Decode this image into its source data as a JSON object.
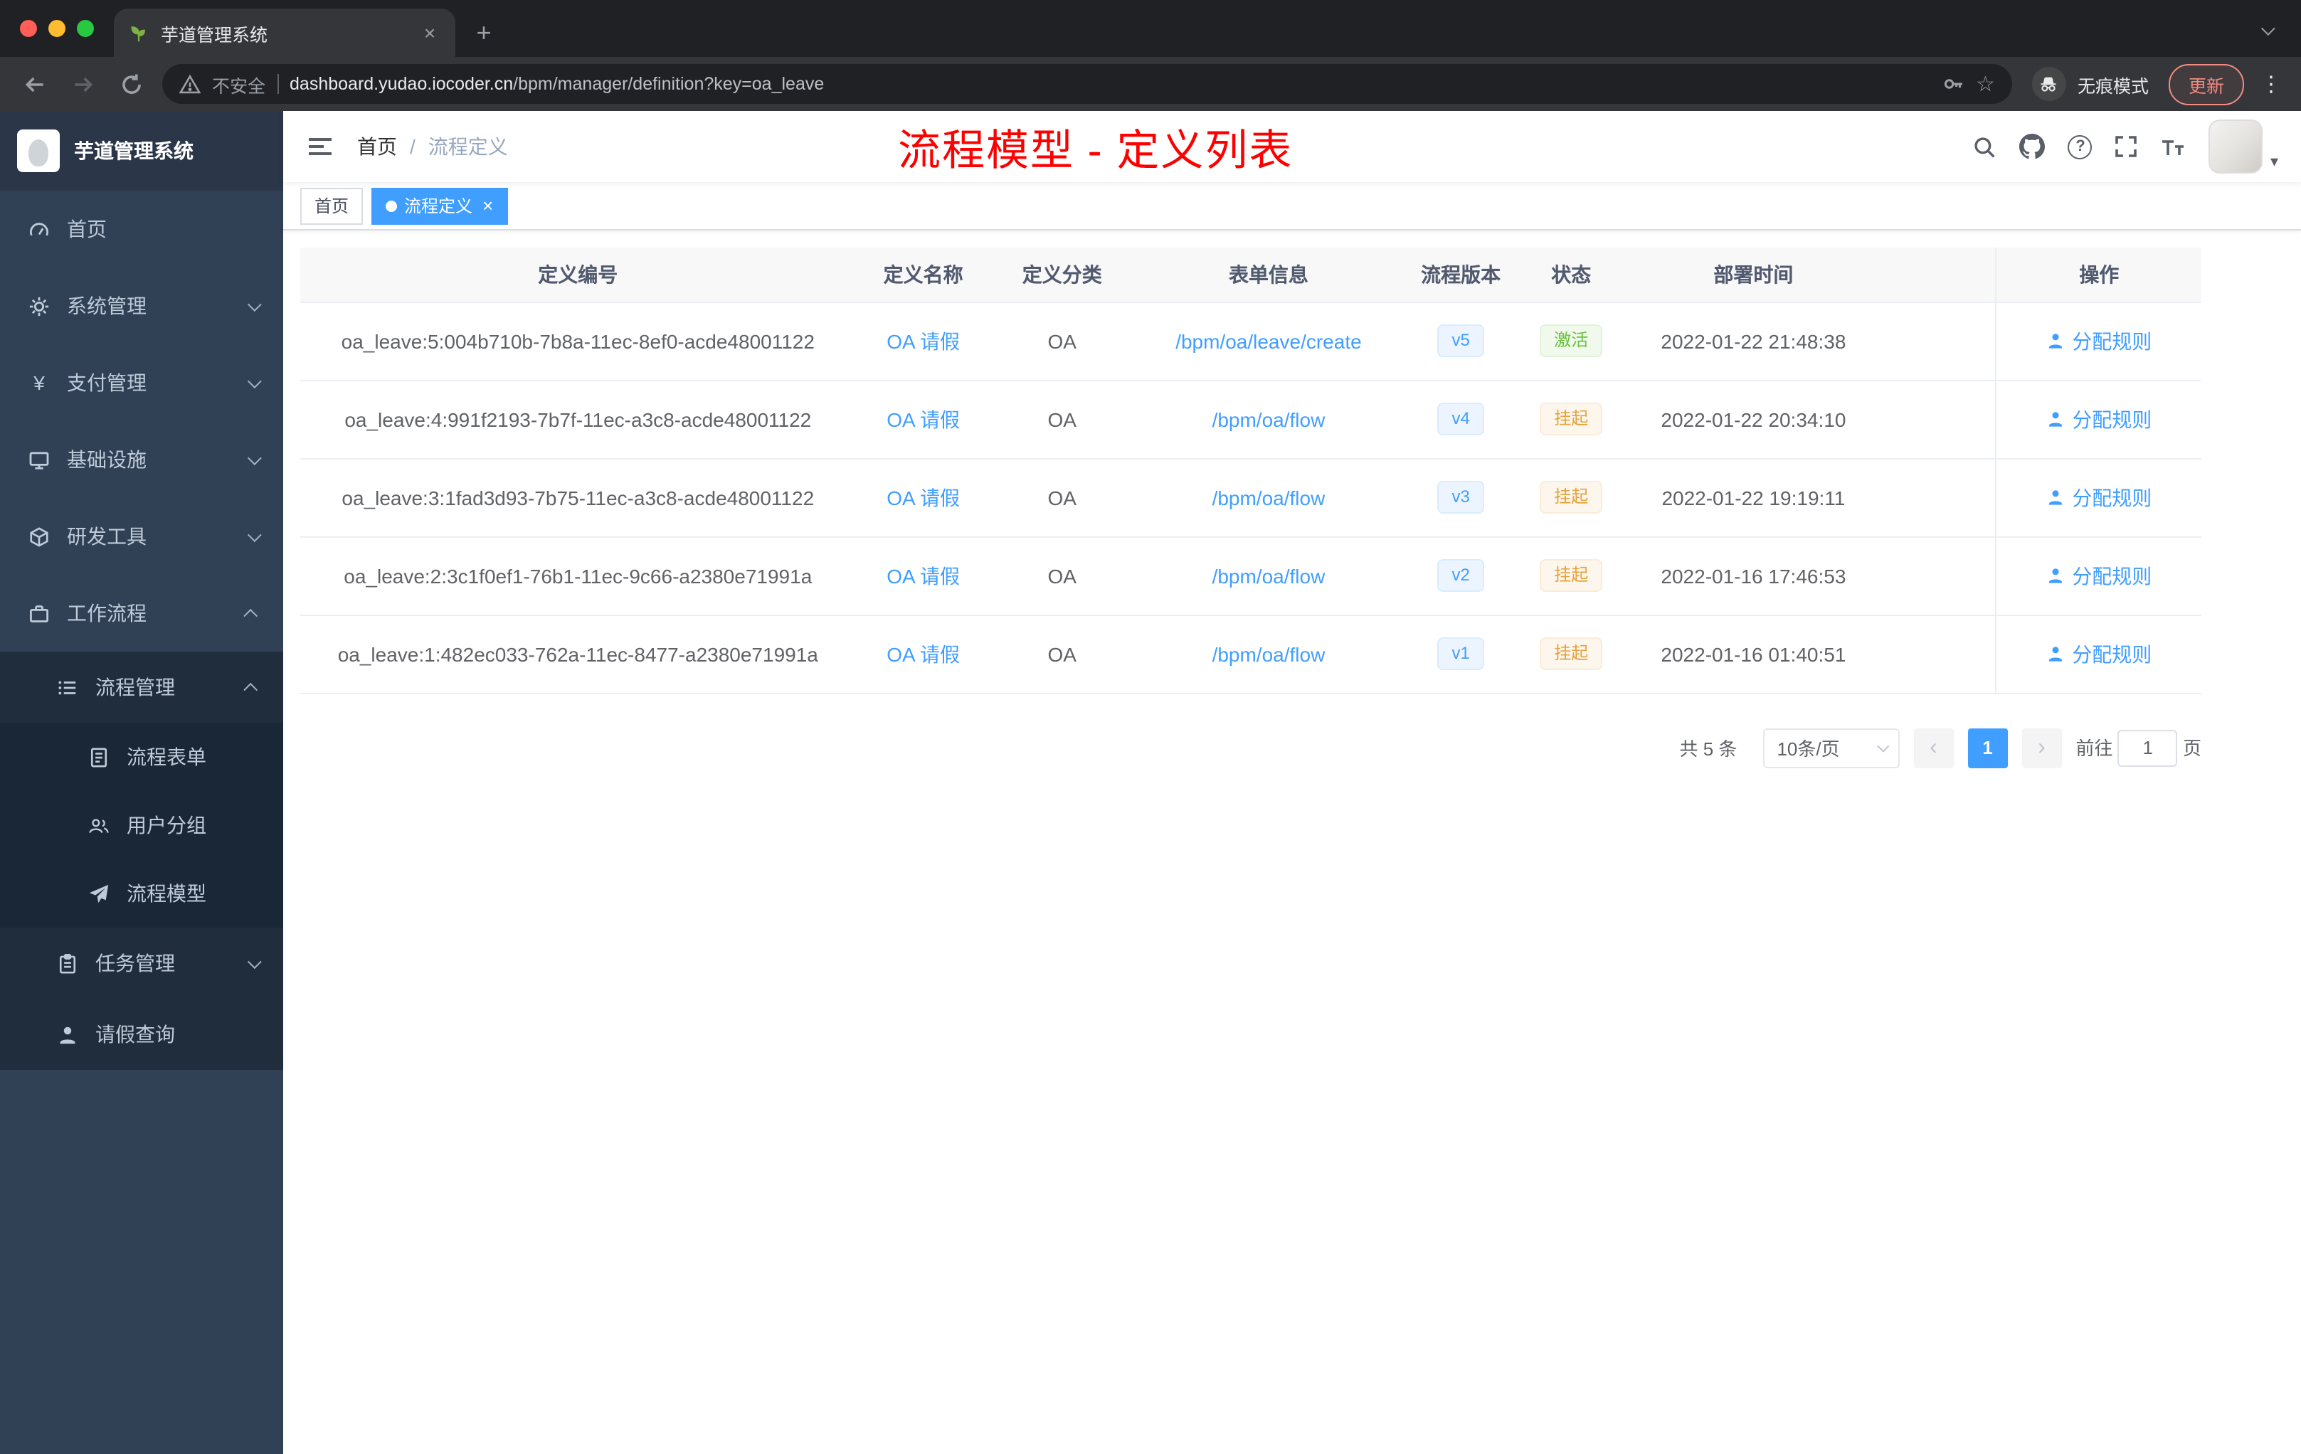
{
  "browser": {
    "tab_title": "芋道管理系统",
    "security": "不安全",
    "url_domain": "dashboard.yudao.iocoder.cn",
    "url_path": "/bpm/manager/definition?key=oa_leave",
    "incognito": "无痕模式",
    "update": "更新"
  },
  "icons": {
    "close": "×",
    "plus": "+",
    "more": "⋮",
    "star": "☆",
    "help": "?",
    "yen": "¥",
    "prev": "‹",
    "next": "›",
    "caret": "▾"
  },
  "sidebar": {
    "title": "芋道管理系统",
    "items": [
      {
        "label": "首页"
      },
      {
        "label": "系统管理"
      },
      {
        "label": "支付管理"
      },
      {
        "label": "基础设施"
      },
      {
        "label": "研发工具"
      },
      {
        "label": "工作流程"
      },
      {
        "label": "流程管理"
      },
      {
        "label": "流程表单"
      },
      {
        "label": "用户分组"
      },
      {
        "label": "流程模型"
      },
      {
        "label": "任务管理"
      },
      {
        "label": "请假查询"
      }
    ]
  },
  "navbar": {
    "breadcrumb": {
      "home": "首页",
      "sep": "/",
      "current": "流程定义"
    },
    "annotation": "流程模型 - 定义列表"
  },
  "tags": {
    "home": "首页",
    "current": "流程定义"
  },
  "table": {
    "headers": [
      "定义编号",
      "定义名称",
      "定义分类",
      "表单信息",
      "流程版本",
      "状态",
      "部署时间",
      "操作"
    ],
    "action_label": "分配规则",
    "rows": [
      {
        "id": "oa_leave:5:004b710b-7b8a-11ec-8ef0-acde48001122",
        "name": "OA 请假",
        "category": "OA",
        "form": "/bpm/oa/leave/create",
        "version": "v5",
        "status": "激活",
        "time": "2022-01-22 21:48:38"
      },
      {
        "id": "oa_leave:4:991f2193-7b7f-11ec-a3c8-acde48001122",
        "name": "OA 请假",
        "category": "OA",
        "form": "/bpm/oa/flow",
        "version": "v4",
        "status": "挂起",
        "time": "2022-01-22 20:34:10"
      },
      {
        "id": "oa_leave:3:1fad3d93-7b75-11ec-a3c8-acde48001122",
        "name": "OA 请假",
        "category": "OA",
        "form": "/bpm/oa/flow",
        "version": "v3",
        "status": "挂起",
        "time": "2022-01-22 19:19:11"
      },
      {
        "id": "oa_leave:2:3c1f0ef1-76b1-11ec-9c66-a2380e71991a",
        "name": "OA 请假",
        "category": "OA",
        "form": "/bpm/oa/flow",
        "version": "v2",
        "status": "挂起",
        "time": "2022-01-16 17:46:53"
      },
      {
        "id": "oa_leave:1:482ec033-762a-11ec-8477-a2380e71991a",
        "name": "OA 请假",
        "category": "OA",
        "form": "/bpm/oa/flow",
        "version": "v1",
        "status": "挂起",
        "time": "2022-01-16 01:40:51"
      }
    ]
  },
  "pagination": {
    "total": "共 5 条",
    "page_size": "10条/页",
    "page": "1",
    "goto_label": "前往",
    "goto_value": "1",
    "goto_suffix": "页"
  },
  "colors": {
    "accent": "#409eff",
    "success": "#67c23a",
    "warning": "#e6a23c",
    "annotation": "#ff0000",
    "sidebar_bg": "#304156",
    "submenu_bg": "#1f2d3d",
    "active_tag": "#409eff"
  }
}
